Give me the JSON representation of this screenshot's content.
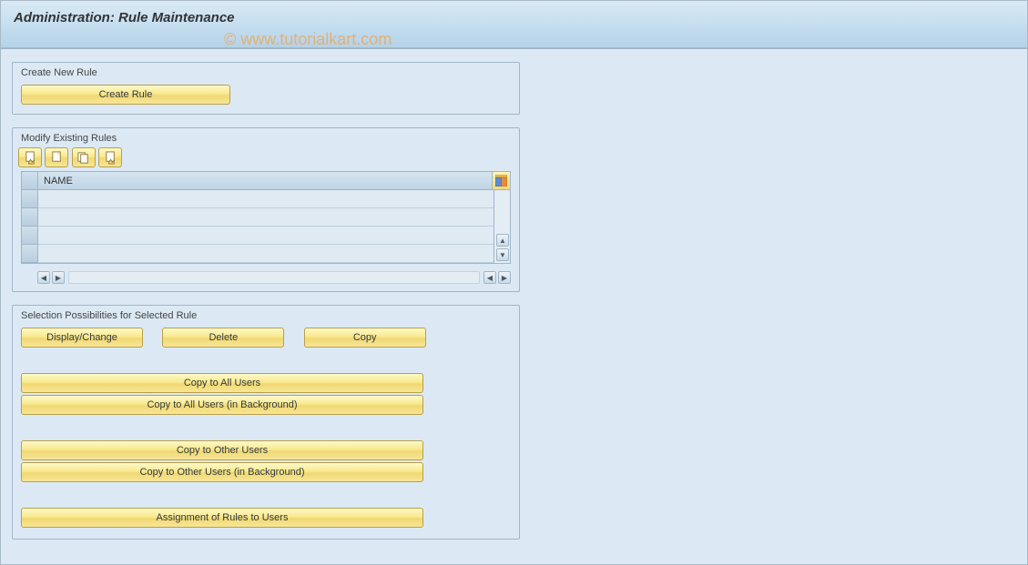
{
  "title": "Administration: Rule Maintenance",
  "watermark": "© www.tutorialkart.com",
  "group_create": {
    "label": "Create New Rule",
    "button": "Create Rule"
  },
  "group_modify": {
    "label": "Modify Existing Rules",
    "column_header": "NAME",
    "rows": [
      "",
      "",
      "",
      ""
    ]
  },
  "group_selection": {
    "label": "Selection Possibilities for Selected Rule",
    "btn_display_change": "Display/Change",
    "btn_delete": "Delete",
    "btn_copy": "Copy",
    "btn_copy_all": "Copy to All Users",
    "btn_copy_all_bg": "Copy to All Users (in Background)",
    "btn_copy_other": "Copy to Other Users",
    "btn_copy_other_bg": "Copy to Other Users (in Background)",
    "btn_assignment": "Assignment of Rules to Users"
  }
}
